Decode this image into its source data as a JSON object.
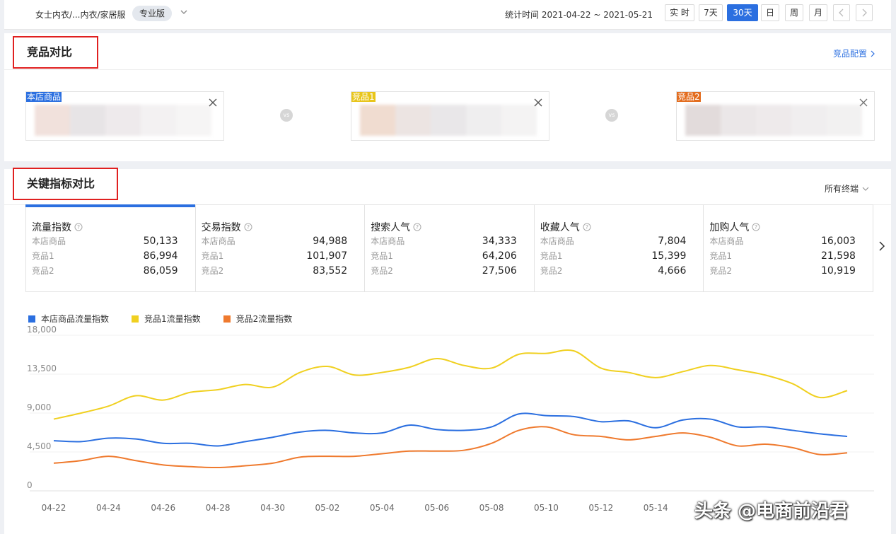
{
  "header": {
    "category": "女士内衣/...内衣/家居服",
    "edition": "专业版",
    "stat_time": "统计时间 2021-04-22 ~ 2021-05-21",
    "ranges": [
      "实 时",
      "7天",
      "30天",
      "日",
      "周",
      "月"
    ],
    "active_range": "30天"
  },
  "compete": {
    "title": "竞品对比",
    "config_link": "竞品配置",
    "products": [
      {
        "tag": "本店商品",
        "tag_color": "#2b6fe0"
      },
      {
        "tag": "竞品1",
        "tag_color": "#e8c51a"
      },
      {
        "tag": "竞品2",
        "tag_color": "#e36c1e"
      }
    ],
    "vs_label": "vs"
  },
  "metrics": {
    "title": "关键指标对比",
    "terminal": "所有终端",
    "row_labels": [
      "本店商品",
      "竞品1",
      "竞品2"
    ],
    "cards": [
      {
        "name": "流量指数",
        "values": [
          "50,133",
          "86,994",
          "86,059"
        ]
      },
      {
        "name": "交易指数",
        "values": [
          "94,988",
          "101,907",
          "83,552"
        ]
      },
      {
        "name": "搜索人气",
        "values": [
          "34,333",
          "64,206",
          "27,506"
        ]
      },
      {
        "name": "收藏人气",
        "values": [
          "7,804",
          "15,399",
          "4,666"
        ]
      },
      {
        "name": "加购人气",
        "values": [
          "16,003",
          "21,598",
          "10,919"
        ]
      }
    ]
  },
  "chart_data": {
    "type": "line",
    "x": [
      "04-22",
      "04-23",
      "04-24",
      "04-25",
      "04-26",
      "04-27",
      "04-28",
      "04-29",
      "04-30",
      "05-01",
      "05-02",
      "05-03",
      "05-04",
      "05-05",
      "05-06",
      "05-07",
      "05-08",
      "05-09",
      "05-10",
      "05-11",
      "05-12",
      "05-13",
      "05-14",
      "05-15",
      "05-16",
      "05-17",
      "05-18",
      "05-19",
      "05-20",
      "05-21"
    ],
    "x_tick_labels": [
      "04-22",
      "04-24",
      "04-26",
      "04-28",
      "04-30",
      "05-02",
      "05-04",
      "05-06",
      "05-08",
      "05-10",
      "05-12",
      "05-14"
    ],
    "y_ticks": [
      "18,000",
      "13,500",
      "9,000",
      "4,500",
      "0"
    ],
    "ylim": [
      0,
      18000
    ],
    "grid": true,
    "legend_position": "top-left",
    "series": [
      {
        "name": "本店商品流量指数",
        "color": "#2b6fe0",
        "values": [
          5800,
          5700,
          6100,
          6000,
          5500,
          5500,
          5200,
          5700,
          6200,
          6800,
          7000,
          6700,
          6700,
          7600,
          7100,
          7000,
          7400,
          8900,
          8700,
          8600,
          8000,
          8100,
          7300,
          8200,
          8300,
          7400,
          7400,
          7000,
          6600,
          6300
        ]
      },
      {
        "name": "竞品1流量指数",
        "color": "#f0d020",
        "values": [
          8300,
          9000,
          9800,
          11000,
          10500,
          11400,
          11700,
          12300,
          12000,
          13700,
          14400,
          13400,
          13700,
          14300,
          15300,
          14500,
          14200,
          15800,
          15900,
          16200,
          14200,
          13700,
          13100,
          13800,
          14500,
          14000,
          13400,
          12400,
          10800,
          11600
        ]
      },
      {
        "name": "竞品2流量指数",
        "color": "#ef7a2e",
        "values": [
          3200,
          3500,
          4000,
          3500,
          3000,
          2800,
          2700,
          2900,
          3200,
          3900,
          4000,
          4000,
          4300,
          4600,
          4600,
          4700,
          5500,
          7000,
          7400,
          6500,
          6300,
          5900,
          6300,
          6700,
          6200,
          5200,
          5400,
          5000,
          4200,
          4400
        ]
      }
    ]
  },
  "watermark": "头条 @电商前沿君"
}
